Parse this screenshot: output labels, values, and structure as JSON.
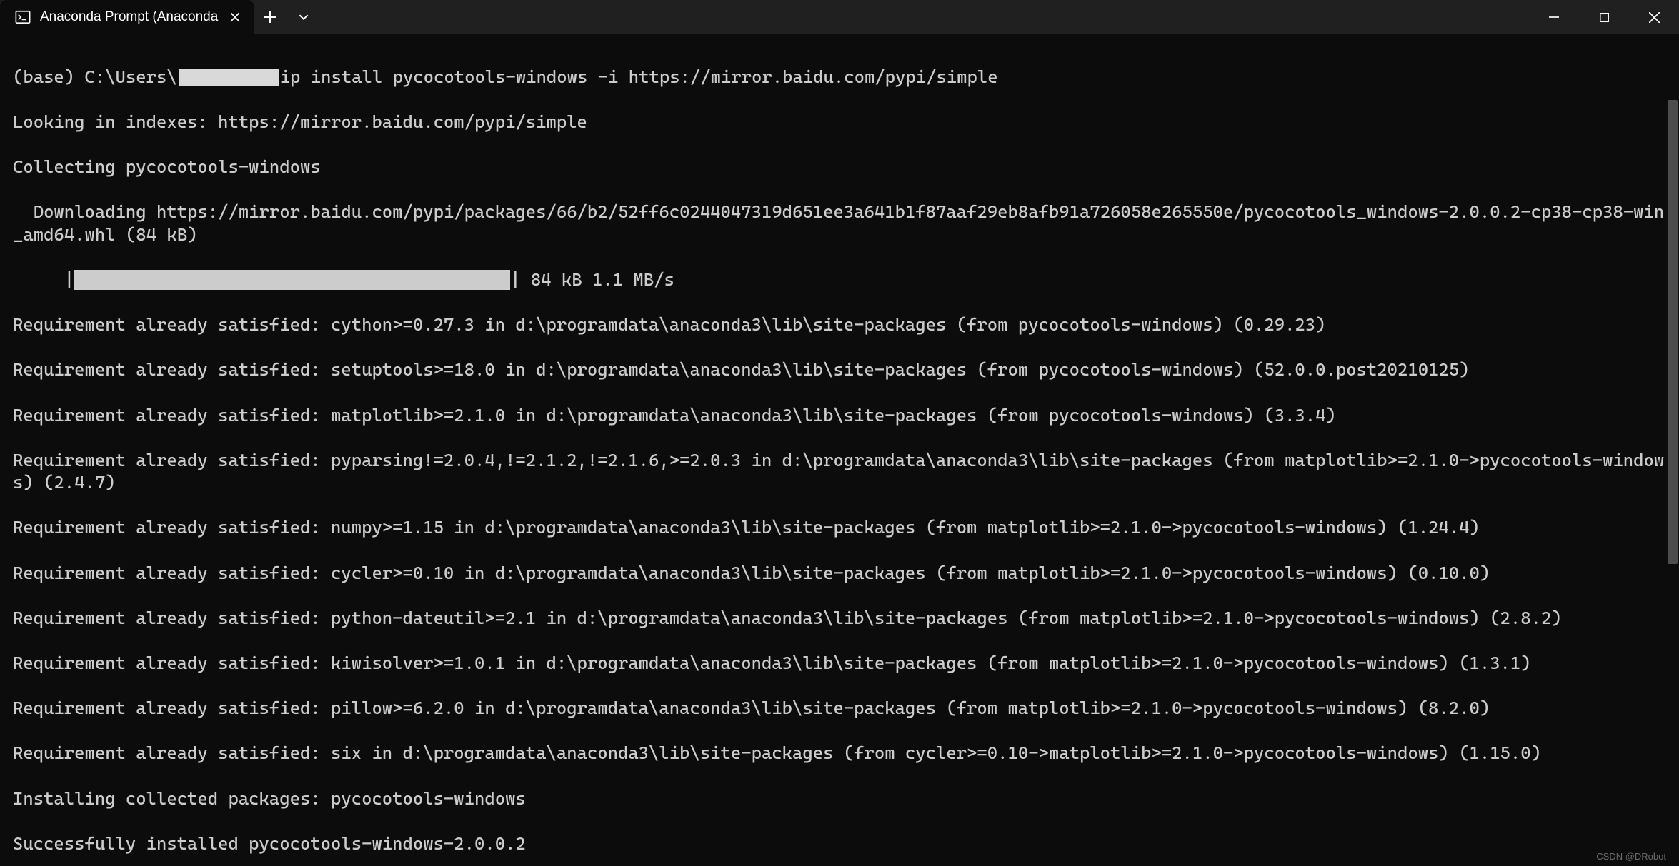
{
  "tab": {
    "title": "Anaconda Prompt (Anaconda"
  },
  "term": {
    "prompt_prefix": "(base) C:\\Users\\",
    "cmd_suffix": "ip install pycocotools-windows -i https://mirror.baidu.com/pypi/simple",
    "l1": "Looking in indexes: https://mirror.baidu.com/pypi/simple",
    "l2": "Collecting pycocotools-windows",
    "l3": "  Downloading https://mirror.baidu.com/pypi/packages/66/b2/52ff6c0244047319d651ee3a641b1f87aaf29eb8afb91a726058e265550e/pycocotools_windows-2.0.0.2-cp38-cp38-win_amd64.whl (84 kB)",
    "prog_left": "     |",
    "prog_right": "| 84 kB 1.1 MB/s",
    "l5": "Requirement already satisfied: cython>=0.27.3 in d:\\programdata\\anaconda3\\lib\\site-packages (from pycocotools-windows) (0.29.23)",
    "l6": "Requirement already satisfied: setuptools>=18.0 in d:\\programdata\\anaconda3\\lib\\site-packages (from pycocotools-windows) (52.0.0.post20210125)",
    "l7": "Requirement already satisfied: matplotlib>=2.1.0 in d:\\programdata\\anaconda3\\lib\\site-packages (from pycocotools-windows) (3.3.4)",
    "l8": "Requirement already satisfied: pyparsing!=2.0.4,!=2.1.2,!=2.1.6,>=2.0.3 in d:\\programdata\\anaconda3\\lib\\site-packages (from matplotlib>=2.1.0->pycocotools-windows) (2.4.7)",
    "l9": "Requirement already satisfied: numpy>=1.15 in d:\\programdata\\anaconda3\\lib\\site-packages (from matplotlib>=2.1.0->pycocotools-windows) (1.24.4)",
    "l10": "Requirement already satisfied: cycler>=0.10 in d:\\programdata\\anaconda3\\lib\\site-packages (from matplotlib>=2.1.0->pycocotools-windows) (0.10.0)",
    "l11": "Requirement already satisfied: python-dateutil>=2.1 in d:\\programdata\\anaconda3\\lib\\site-packages (from matplotlib>=2.1.0->pycocotools-windows) (2.8.2)",
    "l12": "Requirement already satisfied: kiwisolver>=1.0.1 in d:\\programdata\\anaconda3\\lib\\site-packages (from matplotlib>=2.1.0->pycocotools-windows) (1.3.1)",
    "l13": "Requirement already satisfied: pillow>=6.2.0 in d:\\programdata\\anaconda3\\lib\\site-packages (from matplotlib>=2.1.0->pycocotools-windows) (8.2.0)",
    "l14": "Requirement already satisfied: six in d:\\programdata\\anaconda3\\lib\\site-packages (from cycler>=0.10->matplotlib>=2.1.0->pycocotools-windows) (1.15.0)",
    "l15": "Installing collected packages: pycocotools-windows",
    "l16": "Successfully installed pycocotools-windows-2.0.0.2"
  },
  "watermark": "CSDN @DRobot"
}
